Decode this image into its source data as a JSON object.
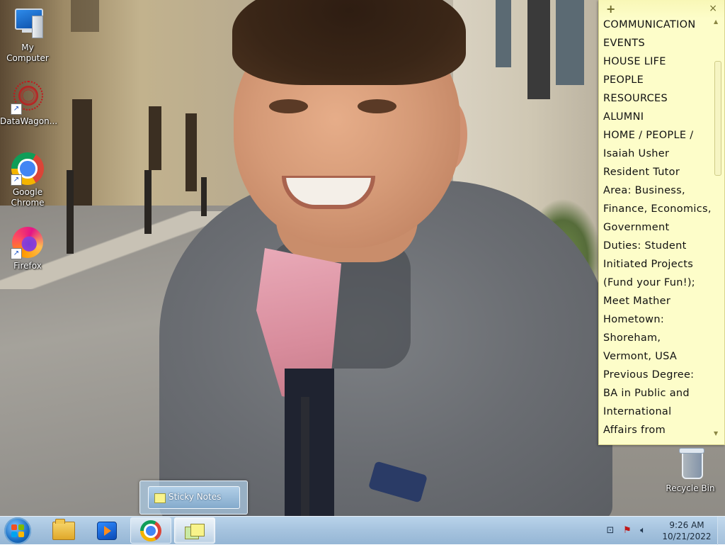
{
  "desktop": {
    "icons": [
      {
        "label": "My Computer",
        "icon": "computer-icon"
      },
      {
        "label": "DataWagon...",
        "icon": "datawagon-icon"
      },
      {
        "label": "Google Chrome",
        "line1": "Google",
        "line2": "Chrome",
        "icon": "chrome-icon"
      },
      {
        "label": "Firefox",
        "icon": "firefox-icon"
      },
      {
        "label": "Recycle Bin",
        "icon": "recycle-bin-icon"
      }
    ]
  },
  "sticky_note": {
    "add_symbol": "+",
    "close_symbol": "×",
    "lines": [
      "COMMUNICATION",
      "EVENTS",
      "HOUSE LIFE",
      "PEOPLE",
      "RESOURCES",
      "ALUMNI",
      "HOME / PEOPLE /",
      "Isaiah Usher",
      "Resident Tutor",
      "Area: Business,",
      "Finance, Economics,",
      "Government",
      "Duties: Student",
      "Initiated Projects",
      "(Fund your Fun!);",
      "Meet Mather",
      "Hometown:",
      "Shoreham,",
      "Vermont, USA",
      "Previous Degree:",
      "BA in Public and",
      "International",
      "Affairs from"
    ]
  },
  "taskbar": {
    "thumbnail_title": "Sticky Notes",
    "buttons": [
      {
        "name": "windows-explorer",
        "icon": "folder-icon"
      },
      {
        "name": "windows-media-player",
        "icon": "media-player-icon"
      },
      {
        "name": "google-chrome",
        "icon": "chrome-icon"
      },
      {
        "name": "sticky-notes",
        "icon": "sticky-notes-icon"
      }
    ],
    "clock": {
      "time": "9:26 AM",
      "date": "10/21/2022"
    }
  },
  "colors": {
    "sticky_bg": "#fdfdc9",
    "taskbar": "#a7c4df"
  }
}
